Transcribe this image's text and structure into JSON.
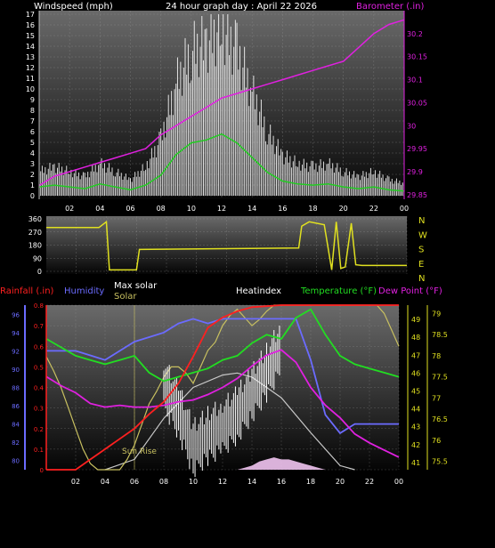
{
  "colors": {
    "background": "#000000",
    "panel_top": "#6a6a6a",
    "panel_bottom": "#000000",
    "grid": "#9a9a9a",
    "wind_speed": "#ffffff",
    "wind_avg": "#22cc22",
    "barometer": "#e020e0",
    "wind_dir": "#e0e020",
    "rainfall": "#ff2020",
    "humidity": "#6b6bff",
    "max_solar": "#c8c8c8",
    "solar": "#c8c060",
    "heatindex": "#ffffff",
    "temperature": "#22dd22",
    "dew_point": "#e020e0",
    "sunrise_line": "#c8c060",
    "uv_fill": "#ffd0ff"
  },
  "header": {
    "left_label": "Windspeed (mph)",
    "title": "24 hour graph day : April 22 2026",
    "right_label": "Barometer (.in)"
  },
  "x_ticks": [
    "02",
    "04",
    "06",
    "08",
    "10",
    "12",
    "14",
    "16",
    "18",
    "20",
    "22",
    "00"
  ],
  "compass": {
    "labels": [
      "N",
      "W",
      "S",
      "E",
      "N"
    ]
  },
  "bottom_legend": {
    "rainfall": "Rainfall (.in)",
    "humidity": "Humidity",
    "max_solar": "Max solar",
    "solar": "Solar",
    "heatindex": "Heatindex",
    "temperature": "Temperature (°F)",
    "dew_point": "Dew Point (°F)",
    "sunrise": "Sun Rise"
  },
  "chart_data": [
    {
      "type": "line",
      "name": "wind-barometer",
      "x_range_hours": [
        0,
        24
      ],
      "left_axis": {
        "label": "Windspeed (mph)",
        "ticks": [
          0,
          1,
          2,
          3,
          4,
          5,
          6,
          7,
          8,
          9,
          10,
          11,
          12,
          13,
          14,
          15,
          16,
          17
        ],
        "ylim": [
          0,
          17
        ]
      },
      "right_axis": {
        "label": "Barometer (.in)",
        "ticks": [
          29.85,
          29.9,
          29.95,
          30,
          30.05,
          30.1,
          30.15,
          30.2
        ],
        "ylim": [
          29.84,
          30.25
        ]
      },
      "series": [
        {
          "name": "Windspeed",
          "axis": "left",
          "x": [
            0,
            1,
            2,
            3,
            4,
            5,
            6,
            7,
            8,
            9,
            10,
            11,
            12,
            13,
            14,
            15,
            16,
            17,
            18,
            19,
            20,
            21,
            22,
            23,
            24
          ],
          "values": [
            1.5,
            1.8,
            1.5,
            1.2,
            2,
            1.5,
            1,
            1.8,
            3.5,
            7,
            9,
            9.5,
            10.5,
            9,
            6.5,
            4,
            2.5,
            2,
            1.8,
            2,
            1.5,
            1.2,
            1.5,
            1,
            0.8
          ]
        },
        {
          "name": "Barometer",
          "axis": "right",
          "x": [
            0,
            1,
            2,
            3,
            4,
            5,
            6,
            7,
            8,
            9,
            10,
            11,
            12,
            13,
            14,
            15,
            16,
            17,
            18,
            19,
            20,
            21,
            22,
            23,
            24
          ],
          "values": [
            29.87,
            29.89,
            29.9,
            29.91,
            29.92,
            29.93,
            29.94,
            29.95,
            29.98,
            30.0,
            30.02,
            30.04,
            30.06,
            30.07,
            30.08,
            30.09,
            30.1,
            30.11,
            30.12,
            30.13,
            30.14,
            30.17,
            30.2,
            30.22,
            30.23
          ]
        }
      ]
    },
    {
      "type": "line",
      "name": "wind-direction",
      "x_range_hours": [
        0,
        24
      ],
      "left_axis": {
        "ticks": [
          0,
          90,
          180,
          270,
          360
        ],
        "ylim": [
          0,
          360
        ]
      },
      "series": [
        {
          "name": "Wind Direction",
          "x": [
            0,
            3.5,
            4,
            4.2,
            6,
            6.2,
            16.8,
            17,
            17.5,
            18.5,
            19,
            19.3,
            19.6,
            19.9,
            20.3,
            20.6,
            21,
            24
          ],
          "values": [
            300,
            300,
            340,
            10,
            10,
            150,
            160,
            310,
            340,
            320,
            10,
            340,
            20,
            30,
            330,
            45,
            40,
            40
          ]
        }
      ]
    },
    {
      "type": "line",
      "name": "temperature-humidity-solar",
      "x_range_hours": [
        0,
        24
      ],
      "axes": {
        "humidity": {
          "ticks": [
            80,
            82,
            84,
            86,
            88,
            90,
            92,
            94,
            96
          ],
          "ylim": [
            79,
            97
          ]
        },
        "rainfall": {
          "ticks": [
            0,
            0.1,
            0.2,
            0.3,
            0.4,
            0.5,
            0.6,
            0.7,
            0.8
          ],
          "ylim": [
            0,
            0.8
          ]
        },
        "dew_point": {
          "ticks": [
            41,
            42,
            43,
            44,
            45,
            46,
            47,
            48,
            49
          ],
          "ylim": [
            40.6,
            49.8
          ]
        },
        "temperature": {
          "ticks": [
            75.5,
            76,
            76.5,
            77,
            77.5,
            78,
            78.5,
            79
          ],
          "ylim": [
            75.3,
            79.2
          ]
        }
      },
      "series": [
        {
          "name": "Rainfall",
          "axis": "rainfall",
          "x": [
            0,
            2,
            3,
            4,
            5,
            6,
            7,
            8,
            9,
            10,
            11,
            12,
            13,
            14,
            16,
            20,
            24
          ],
          "values": [
            0,
            0,
            0.05,
            0.1,
            0.15,
            0.2,
            0.27,
            0.33,
            0.42,
            0.55,
            0.69,
            0.74,
            0.77,
            0.79,
            0.8,
            0.8,
            0.8
          ]
        },
        {
          "name": "Humidity",
          "axis": "humidity",
          "x": [
            0,
            1,
            2,
            3,
            4,
            5,
            6,
            7,
            8,
            9,
            10,
            11,
            12,
            13,
            14,
            15,
            16,
            17,
            18,
            19,
            20,
            21,
            22,
            23,
            24
          ],
          "values": [
            92,
            92,
            92,
            91.5,
            91,
            92,
            93,
            93.5,
            94,
            95,
            95.5,
            95,
            95.5,
            95.5,
            95.5,
            95.5,
            95.5,
            95.5,
            91,
            85,
            83,
            84,
            84,
            84,
            84
          ]
        },
        {
          "name": "Max solar",
          "axis": "rainfall",
          "x": [
            4,
            6,
            8,
            10,
            12,
            13,
            14,
            16,
            18,
            20,
            21
          ],
          "values": [
            0,
            0.05,
            0.25,
            0.4,
            0.46,
            0.47,
            0.45,
            0.35,
            0.18,
            0.02,
            0
          ]
        },
        {
          "name": "Solar",
          "axis": "rainfall",
          "x": [
            0,
            0.5,
            1,
            1.5,
            2,
            2.5,
            3,
            3.5,
            4,
            4.5,
            5,
            5.5,
            6,
            6.5,
            7,
            7.5,
            8,
            8.5,
            9,
            9.5,
            10,
            10.5,
            11,
            11.5,
            12,
            12.5,
            13,
            13.5,
            14,
            14.5,
            15,
            15.5,
            16,
            16.5,
            17,
            17.5,
            18,
            18.5,
            19,
            19.5,
            20,
            20.5,
            21,
            21.5,
            22,
            22.5,
            23,
            23.5,
            24
          ],
          "values": [
            0.55,
            0.48,
            0.4,
            0.3,
            0.2,
            0.1,
            0.03,
            0,
            0,
            0,
            0,
            0.05,
            0.12,
            0.22,
            0.32,
            0.38,
            0.45,
            0.5,
            0.5,
            0.47,
            0.42,
            0.5,
            0.58,
            0.62,
            0.7,
            0.75,
            0.78,
            0.74,
            0.7,
            0.73,
            0.77,
            0.8,
            0.8,
            0.8,
            0.8,
            0.8,
            0.8,
            0.8,
            0.8,
            0.8,
            0.8,
            0.8,
            0.8,
            0.8,
            0.8,
            0.8,
            0.76,
            0.68,
            0.6
          ]
        },
        {
          "name": "Heatindex",
          "axis": "temperature",
          "x": [
            8,
            9,
            10,
            11,
            12,
            13,
            14,
            15,
            16
          ],
          "values": [
            77.3,
            76.7,
            75.8,
            76.1,
            76.3,
            76.6,
            77.1,
            77.6,
            78.2
          ]
        },
        {
          "name": "Temperature",
          "axis": "temperature",
          "x": [
            0,
            1,
            2,
            3,
            4,
            5,
            6,
            7,
            8,
            9,
            10,
            11,
            12,
            13,
            14,
            15,
            16,
            17,
            18,
            19,
            20,
            21,
            22,
            23,
            24
          ],
          "values": [
            78.4,
            78.2,
            78.0,
            77.9,
            77.8,
            77.9,
            78.0,
            77.6,
            77.4,
            77.5,
            77.6,
            77.7,
            77.9,
            78.0,
            78.3,
            78.5,
            78.4,
            78.9,
            79.1,
            78.5,
            78.0,
            77.8,
            77.7,
            77.6,
            77.5
          ]
        },
        {
          "name": "Dew Point",
          "axis": "dew_point",
          "x": [
            0,
            1,
            2,
            3,
            4,
            5,
            6,
            7,
            8,
            9,
            10,
            11,
            12,
            13,
            14,
            15,
            16,
            17,
            18,
            19,
            20,
            21,
            22,
            23,
            24
          ],
          "values": [
            45.8,
            45.3,
            44.9,
            44.3,
            44.1,
            44.2,
            44.1,
            44.1,
            44.2,
            44.4,
            44.5,
            44.8,
            45.2,
            45.7,
            46.4,
            47.0,
            47.3,
            46.6,
            45.2,
            44.2,
            43.5,
            42.6,
            42.1,
            41.7,
            41.3
          ]
        },
        {
          "name": "UV",
          "axis": "rainfall",
          "x": [
            13,
            13.5,
            14,
            14.5,
            15,
            15.5,
            16,
            16.5,
            17,
            17.5,
            18,
            18.5,
            19
          ],
          "values": [
            0,
            0.01,
            0.02,
            0.04,
            0.05,
            0.06,
            0.05,
            0.05,
            0.04,
            0.03,
            0.02,
            0.01,
            0
          ]
        }
      ]
    }
  ]
}
